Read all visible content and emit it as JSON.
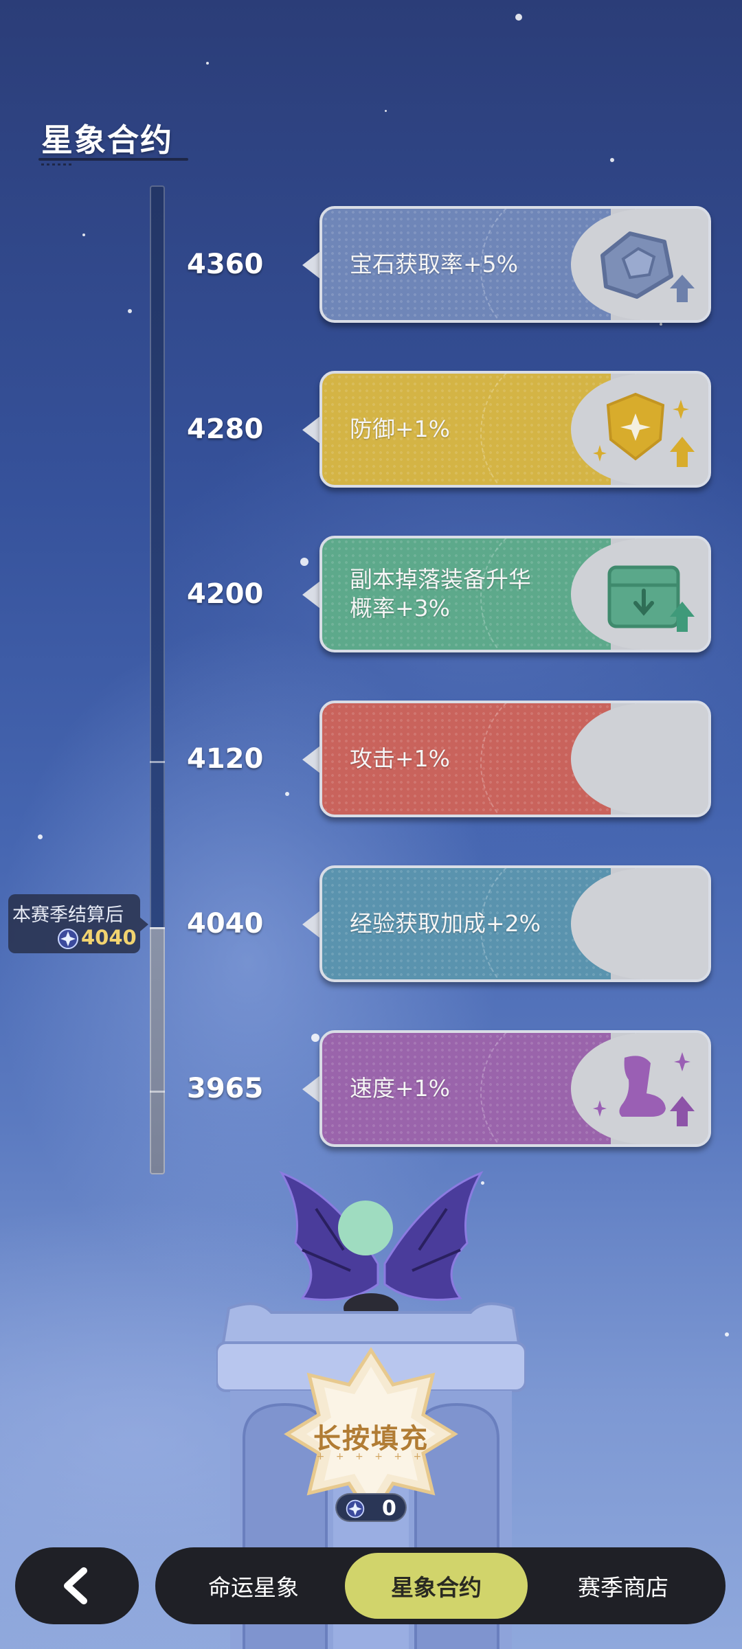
{
  "page": {
    "title": "星象合约"
  },
  "season": {
    "label": "本赛季结算后",
    "value": "4040"
  },
  "tiers": [
    {
      "value": "4360",
      "reward": "宝石获取率+5%",
      "color": "#6f86b8",
      "icon": "gem-upgrade-icon"
    },
    {
      "value": "4280",
      "reward": "防御+1%",
      "color": "#d4b445",
      "icon": "shield-upgrade-icon"
    },
    {
      "value": "4200",
      "reward": "副本掉落装备升华\n概率+3%",
      "color": "#5da98b",
      "icon": "box-upgrade-icon"
    },
    {
      "value": "4120",
      "reward": "攻击+1%",
      "color": "#c9635c",
      "icon": ""
    },
    {
      "value": "4040",
      "reward": "经验获取加成+2%",
      "color": "#5a93ae",
      "icon": ""
    },
    {
      "value": "3965",
      "reward": "速度+1%",
      "color": "#9a64ab",
      "icon": "boot-upgrade-icon"
    }
  ],
  "fill_button": {
    "label": "长按填充",
    "dots": "+ + + + + +"
  },
  "currency": {
    "count": "0",
    "icon": "star-orb-icon"
  },
  "nav": {
    "back_icon": "chevron-left-icon",
    "tabs": [
      {
        "label": "命运星象",
        "active": false
      },
      {
        "label": "星象合约",
        "active": true
      },
      {
        "label": "赛季商店",
        "active": false
      }
    ]
  }
}
